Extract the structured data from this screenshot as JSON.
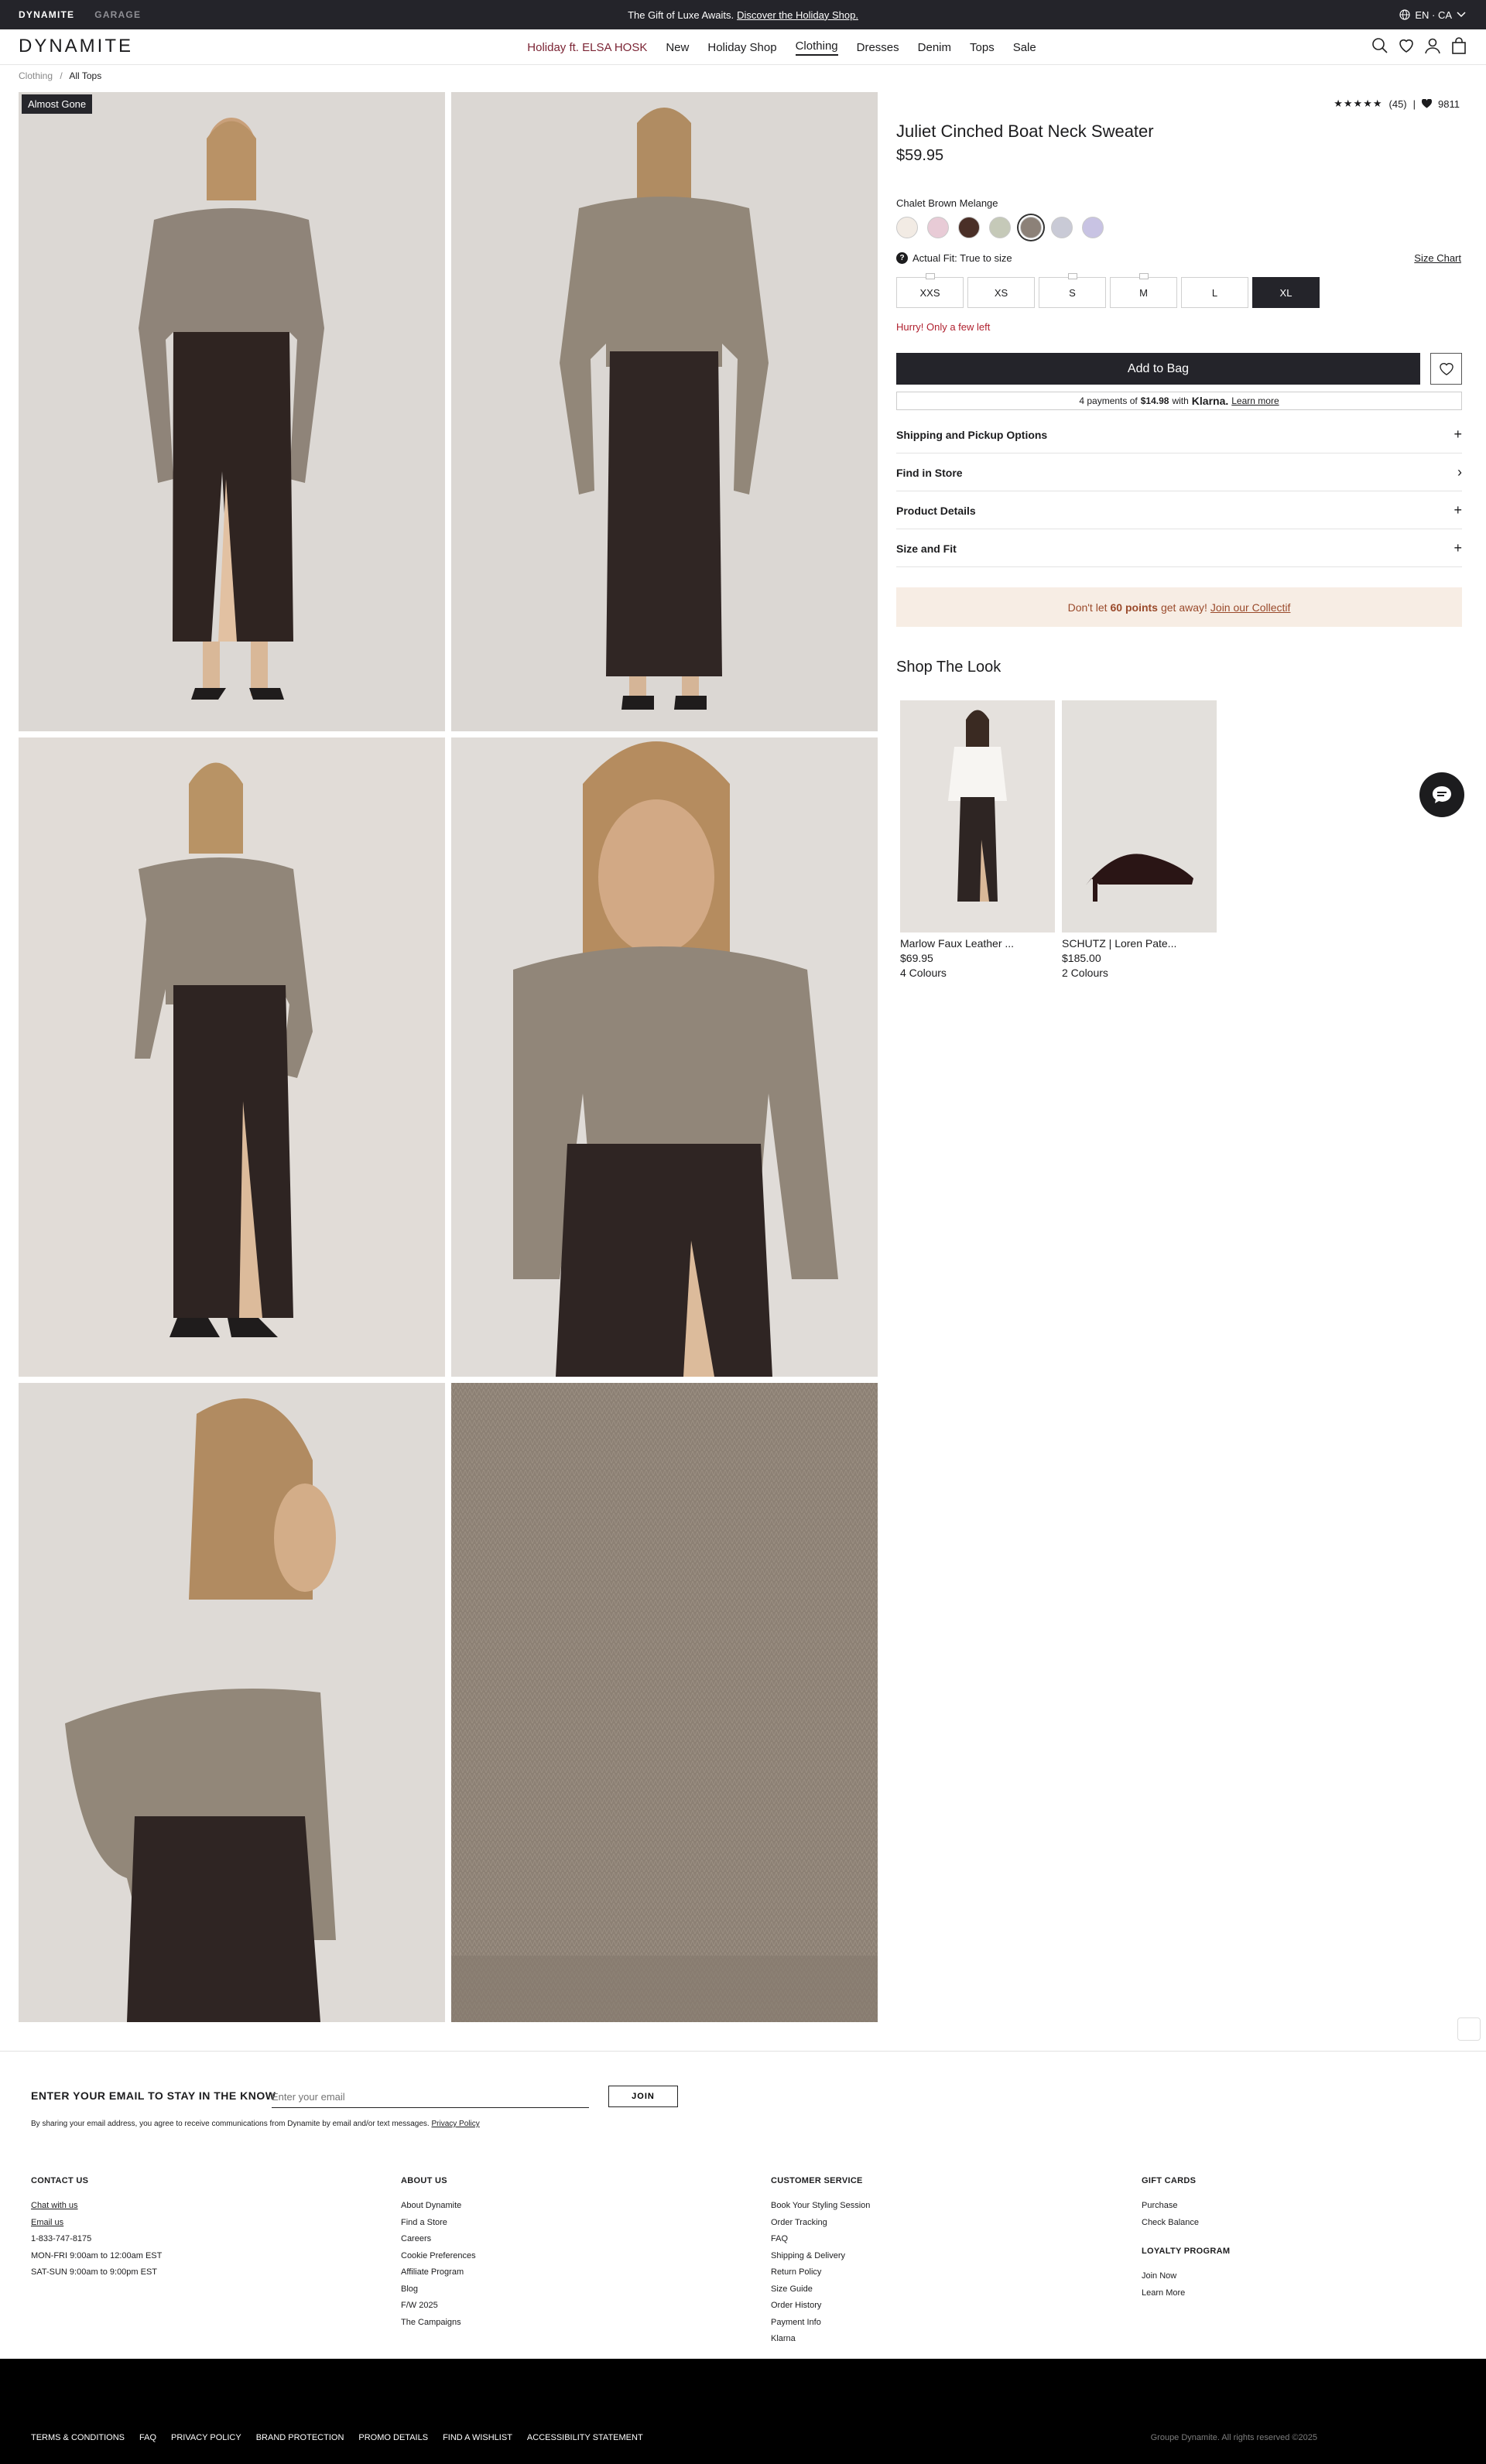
{
  "topbar": {
    "brands": [
      "DYNAMITE",
      "GARAGE"
    ],
    "promo_text": "The Gift of Luxe Awaits.",
    "promo_link": "Discover the Holiday Shop.",
    "locale": "EN · CA"
  },
  "header": {
    "logo": "DYNAMITE",
    "nav": [
      "Holiday ft. ELSA HOSK",
      "New",
      "Holiday Shop",
      "Clothing",
      "Dresses",
      "Denim",
      "Tops",
      "Sale"
    ],
    "icons": [
      "search-icon",
      "heart-icon",
      "account-icon",
      "bag-icon"
    ]
  },
  "breadcrumb": {
    "items": [
      "Clothing",
      "All Tops"
    ],
    "separator": "/"
  },
  "gallery": {
    "badge": "Almost Gone"
  },
  "product": {
    "rating_count": "(45)",
    "likes": "9811",
    "title": "Juliet Cinched Boat Neck Sweater",
    "price": "$59.95",
    "color_name": "Chalet Brown Melange",
    "swatches": [
      "#f2ebe4",
      "#e8cbd6",
      "#4a2f27",
      "#c5c9b8",
      "#8c8178",
      "#c9cad6",
      "#c8c3e3"
    ],
    "fit": "Actual Fit: True to size",
    "size_chart": "Size Chart",
    "sizes": [
      "XXS",
      "XS",
      "S",
      "M",
      "L",
      "XL"
    ],
    "selected_size": "XL",
    "hurry": "Hurry! Only a few left",
    "add_to_bag": "Add to Bag",
    "klarna": {
      "text": "4 payments of",
      "amount": "$14.98",
      "with": "with",
      "brand": "Klarna.",
      "learn": "Learn more"
    },
    "accordions": [
      {
        "label": "Shipping and Pickup Options",
        "icon": "+"
      },
      {
        "label": "Find in Store",
        "icon": "›"
      },
      {
        "label": "Product Details",
        "icon": "+"
      },
      {
        "label": "Size and Fit",
        "icon": "+"
      }
    ],
    "loyalty": {
      "pre": "Don't let",
      "points": "60 points",
      "post": "get away!",
      "link": "Join our Collectif"
    }
  },
  "shop_the_look": {
    "title": "Shop The Look",
    "items": [
      {
        "name": "Marlow Faux Leather ...",
        "price": "$69.95",
        "colours": "4 Colours"
      },
      {
        "name": "SCHUTZ | Loren Pate...",
        "price": "$185.00",
        "colours": "2 Colours"
      }
    ]
  },
  "footer": {
    "signup_title": "ENTER YOUR EMAIL TO STAY IN THE KNOW",
    "email_placeholder": "Enter your email",
    "join": "JOIN",
    "legal_text": "By sharing your email address, you agree to receive communications from Dynamite by email and/or text messages.",
    "privacy": "Privacy Policy",
    "contact": {
      "title": "CONTACT US",
      "chat": "Chat with us",
      "email": "Email us",
      "phone": "1-833-747-8175",
      "hours1": "MON-FRI 9:00am to 12:00am EST",
      "hours2": "SAT-SUN 9:00am to 9:00pm EST"
    },
    "about": {
      "title": "ABOUT US",
      "links": [
        "About Dynamite",
        "Find a Store",
        "Careers",
        "Cookie Preferences",
        "Affiliate Program",
        "Blog",
        "F/W 2025",
        "The Campaigns"
      ]
    },
    "service": {
      "title": "CUSTOMER SERVICE",
      "links": [
        "Book Your Styling Session",
        "Order Tracking",
        "FAQ",
        "Shipping & Delivery",
        "Return Policy",
        "Size Guide",
        "Order History",
        "Payment Info",
        "Klarna"
      ]
    },
    "gift": {
      "title": "GIFT CARDS",
      "links": [
        "Purchase",
        "Check Balance"
      ]
    },
    "loyalty": {
      "title": "LOYALTY PROGRAM",
      "links": [
        "Join Now",
        "Learn More"
      ]
    },
    "bottom_links": [
      "TERMS & CONDITIONS",
      "FAQ",
      "PRIVACY POLICY",
      "BRAND PROTECTION",
      "PROMO DETAILS",
      "FIND A WISHLIST",
      "ACCESSIBILITY STATEMENT"
    ],
    "copyright": "Groupe Dynamite. All rights reserved ©2025"
  }
}
